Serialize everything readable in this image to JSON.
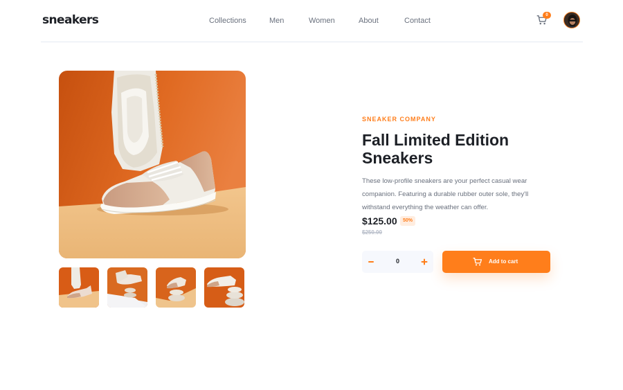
{
  "header": {
    "logo": "sneakers",
    "nav": [
      "Collections",
      "Men",
      "Women",
      "About",
      "Contact"
    ],
    "cart_count": "0",
    "cart_icon": "cart-icon",
    "avatar_icon": "user-avatar"
  },
  "gallery": {
    "main_image": "sneaker-product-photo",
    "thumbnails": [
      "thumbnail-1",
      "thumbnail-2",
      "thumbnail-3",
      "thumbnail-4"
    ]
  },
  "product": {
    "company": "SNEAKER COMPANY",
    "title": "Fall Limited Edition Sneakers",
    "description": "These low-profile sneakers are your perfect casual wear companion. Featuring a durable rubber outer sole, they'll withstand everything the weather can offer.",
    "price": "$125.00",
    "discount": "50%",
    "original_price": "$250.00",
    "quantity": "0",
    "add_to_cart_label": "Add to cart"
  },
  "colors": {
    "accent": "#ff7e1b",
    "accent_pale": "#ffede0",
    "dark": "#1d2026",
    "grey": "#69707d",
    "light_grey": "#f6f8fd"
  }
}
